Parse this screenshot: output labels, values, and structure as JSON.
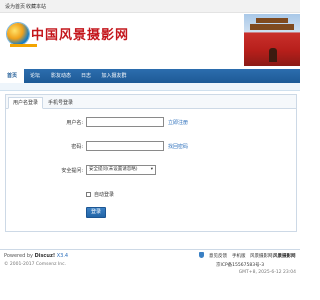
{
  "topbar": {
    "set_home": "设为首页",
    "favorite": "收藏本站"
  },
  "header": {
    "logo_text": "中国风景摄影网"
  },
  "nav": {
    "items": [
      {
        "label": "首页",
        "active": true
      },
      {
        "label": "论坛"
      },
      {
        "label": "影友动态"
      },
      {
        "label": "日志"
      },
      {
        "label": "加入摄友群"
      }
    ]
  },
  "login": {
    "tabs": [
      "用户名登录",
      "手机号登录"
    ],
    "username_label": "用户名:",
    "username_value": "",
    "register_link": "立即注册",
    "password_label": "密码:",
    "password_value": "",
    "forgot_link": "找回密码",
    "security_label": "安全提问:",
    "security_selected": "安全提问(未设置请忽略)",
    "auto_login_label": "自动登录",
    "submit_label": "登录"
  },
  "footer": {
    "powered_by": "Powered by",
    "discuz": "Discuz!",
    "version": "X3.4",
    "links": [
      "意见反馈",
      "手机版",
      "风景摄影网",
      "风景摄影网"
    ],
    "icp": "京ICP备15567583号-3",
    "copyright": "© 2001-2017 Comsenz Inc.",
    "time": "GMT+8, 2025-6-12 23:04"
  },
  "colors": {
    "nav": "#1d5a96",
    "logo": "#c4161c",
    "link": "#2a6ebb"
  }
}
